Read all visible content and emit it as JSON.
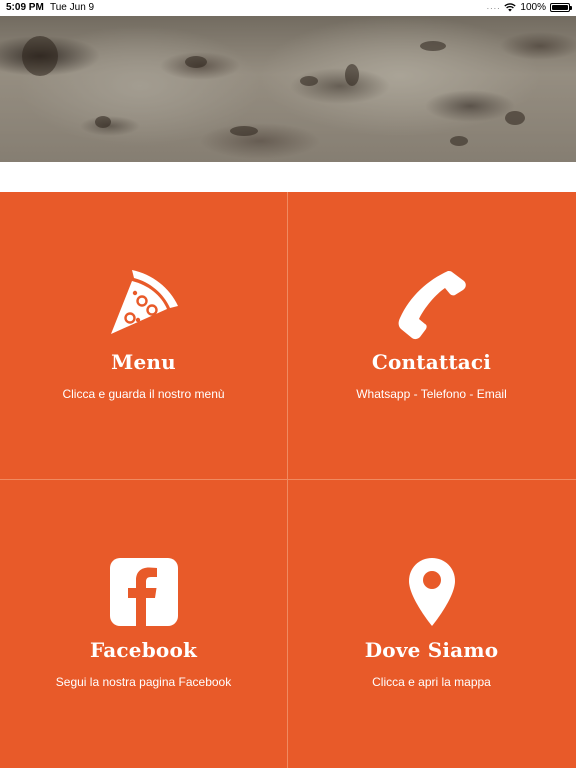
{
  "status_bar": {
    "time": "5:09 PM",
    "date": "Tue Jun 9",
    "battery": "100%"
  },
  "tiles": [
    {
      "title": "Menu",
      "subtitle": "Clicca e guarda il nostro menù",
      "icon": "pizza-slice-icon"
    },
    {
      "title": "Contattaci",
      "subtitle": "Whatsapp - Telefono - Email",
      "icon": "phone-icon"
    },
    {
      "title": "Facebook",
      "subtitle": "Segui la nostra pagina Facebook",
      "icon": "facebook-icon"
    },
    {
      "title": "Dove Siamo",
      "subtitle": "Clicca e apri la mappa",
      "icon": "map-pin-icon"
    }
  ],
  "colors": {
    "accent": "#e85a29",
    "divider": "#f08a60",
    "text_on_accent": "#ffffff"
  }
}
